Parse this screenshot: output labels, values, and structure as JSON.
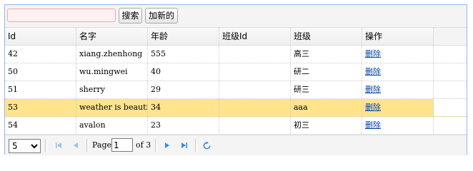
{
  "toolbar": {
    "search_value": "",
    "search_label": "搜索",
    "add_label": "加新的"
  },
  "columns": [
    "Id",
    "名字",
    "年龄",
    "班级Id",
    "班级",
    "操作"
  ],
  "rows": [
    {
      "id": "42",
      "name": "xiang.zhenhong",
      "age": "555",
      "class_id": "",
      "class": "高三",
      "action": "删除",
      "selected": false
    },
    {
      "id": "50",
      "name": "wu.mingwei",
      "age": "40",
      "class_id": "",
      "class": "研二",
      "action": "删除",
      "selected": false
    },
    {
      "id": "51",
      "name": "sherry",
      "age": "29",
      "class_id": "",
      "class": "研三",
      "action": "删除",
      "selected": false
    },
    {
      "id": "53",
      "name": "weather is beautiful",
      "age": "34",
      "class_id": "",
      "class": "aaa",
      "action": "删除",
      "selected": true
    },
    {
      "id": "54",
      "name": "avalon",
      "age": "23",
      "class_id": "",
      "class": "初三",
      "action": "删除",
      "selected": false
    }
  ],
  "pager": {
    "page_size": "5",
    "page_size_options": [
      "5"
    ],
    "page_label": "Page",
    "current_page": "1",
    "of_label": "of 3"
  },
  "colors": {
    "selected_row": "#ffe48d",
    "panel_border": "#95b8e7",
    "pager_icon": "#3c8dde"
  },
  "icons": [
    "first-page-icon",
    "prev-page-icon",
    "next-page-icon",
    "last-page-icon",
    "refresh-icon"
  ]
}
